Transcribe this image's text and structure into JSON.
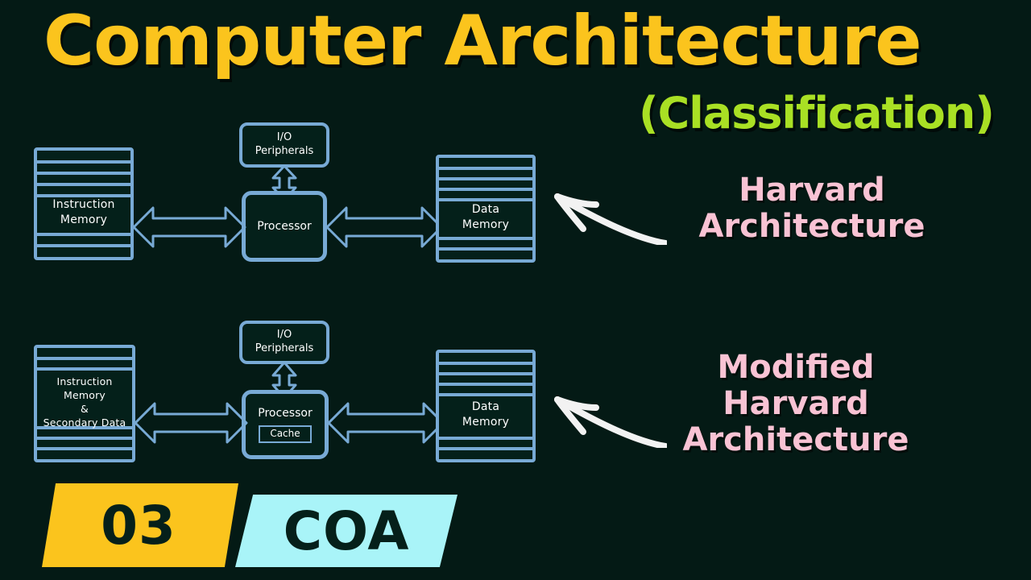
{
  "title": {
    "main": "Computer Architecture",
    "sub": "(Classification)",
    "main_color": "#fbc41d",
    "sub_color": "#a9e024"
  },
  "colors": {
    "background": "#041a15",
    "diagram_blue": "#78aad5",
    "annotation_pink": "#f9c3d4",
    "banner_yellow": "#fbc41d",
    "banner_cyan": "#a9f4f8",
    "box_text": "#ffffff"
  },
  "diagrams": [
    {
      "id": "harvard",
      "annotation": "Harvard Architecture",
      "annotation_lines": [
        "Harvard",
        "Architecture"
      ],
      "blocks": {
        "left_memory": "Instruction\nMemory",
        "left_memory_lines": [
          "Instruction",
          "Memory"
        ],
        "processor": "Processor",
        "io": "I/O Peripherals",
        "io_lines": [
          "I/O",
          "Peripherals"
        ],
        "right_memory": "Data\nMemory",
        "right_memory_lines": [
          "Data",
          "Memory"
        ],
        "cache": null
      }
    },
    {
      "id": "modified-harvard",
      "annotation": "Modified Harvard Architecture",
      "annotation_lines": [
        "Modified",
        "Harvard",
        "Architecture"
      ],
      "blocks": {
        "left_memory": "Instruction Memory & Secondary Data",
        "left_memory_lines": [
          "Instruction",
          "Memory",
          "&",
          "Secondary Data"
        ],
        "processor": "Processor",
        "io": "I/O Peripherals",
        "io_lines": [
          "I/O",
          "Peripherals"
        ],
        "right_memory": "Data\nMemory",
        "right_memory_lines": [
          "Data",
          "Memory"
        ],
        "cache": "Cache"
      }
    }
  ],
  "banner": {
    "number": "03",
    "course": "COA"
  }
}
